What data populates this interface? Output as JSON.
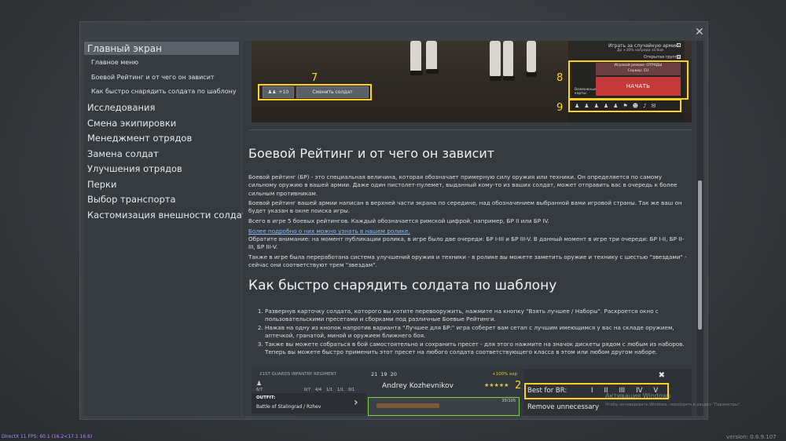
{
  "sidebar": {
    "items": [
      {
        "label": "Главный экран"
      },
      {
        "label": "Главное меню"
      },
      {
        "label": "Боевой Рейтинг и от чего он зависит"
      },
      {
        "label": "Как быстро снарядить солдата по шаблону"
      },
      {
        "label": "Исследования"
      },
      {
        "label": "Смена экипировки"
      },
      {
        "label": "Менеджмент отрядов"
      },
      {
        "label": "Замена солдат"
      },
      {
        "label": "Улучшения отрядов"
      },
      {
        "label": "Перки"
      },
      {
        "label": "Выбор транспорта"
      },
      {
        "label": "Кастомизация внешности солдат"
      }
    ]
  },
  "screenshot_top": {
    "random_army_label": "Играть за случайную армию",
    "random_army_bonus": "До +30% награда за бой",
    "open_group_label": "Открытая группа",
    "mode_label": "Игровой режим: ОТРЯДЫ",
    "server_label": "Сервер: EU",
    "start_label": "НАЧАТЬ",
    "possible_maps_label": "Возможные карты:",
    "change_soldier_label": "Сменить солдат",
    "squad_count": "+10",
    "marker_7": "7",
    "marker_8": "8",
    "marker_9": "9"
  },
  "section1": {
    "title": "Боевой Рейтинг и от чего он зависит",
    "p1": "Боевой рейтинг (БР) - это специальная величина, которая обозначает примерную силу оружия или техники. Он определяется по самому сильному оружию в вашей армии. Даже один пистолет-пулемет, выданный кому-то из ваших солдат, может отправить вас в очередь к более сильным противникам.",
    "p2": "Боевой рейтинг вашей армии написан в верхней части экрана по середине, над обозначением выбранной вами игровой страны. Так же ваш он будет указан в окне поиска игры.",
    "p3": "Всего в игре 5 боевых рейтингов. Каждый обозначается римской цифрой, например, БР II или БР IV.",
    "link": "Более подробно о них можно узнать в нашем ролике.",
    "p4": "Обратите внимание: на момент публикации ролика, в игре было две очереди: БР I-III и БР III-V. В данный момент в игре три очереди: БР I-II, БР II-III, БР III-V.",
    "p5": "Также в игре была переработана система улучшений оружия и техники - в ролике вы можете заметить оружие и технику с шестью \"звездами\" - сейчас они соответствуют трем \"звездам\"."
  },
  "section2": {
    "title": "Как быстро снарядить солдата по шаблону",
    "steps": [
      "Развернув карточку солдата, которого вы хотите перевооружить, нажмите на кнопку \"Взять лучшее / Наборы\". Раскроется окно с пользовательскими пресетами и сборками под различные Боевые Рейтинги.",
      "Нажав на одну из кнопок напротив варианта \"Лучшее для БР:\" игра соберет вам сетап с лучшим имеющимся у вас на складе оружием, аптечкой, гранатой, миной и оружием ближнего боя.",
      "Также вы можете собраться в бой самостоятельно и сохранить пресет - для этого нажмите на значок дискеты рядом с любым из наборов. Теперь вы можете быстро применить этот пресет на любого солдата соответствующего класса в этом или любом другом наборе."
    ]
  },
  "screenshot_bottom": {
    "regiment": "21ST GUARDS INFANTRY REGIMENT",
    "soldier_stats": "21",
    "stat2": "19",
    "stat3": "20",
    "exp": "+100% exp",
    "soldier_name": "Andrey Kozhevnikov",
    "squad_count": "6/7",
    "slot_counts": [
      "0/7",
      "4/4",
      "1/1",
      "1/1",
      "0/1"
    ],
    "outfit_label": "OUTFIT:",
    "outfit_value": "Battle of Stalingrad / Rzhev",
    "ammo": "35/105",
    "best_for_br_label": "Best for BR:",
    "br_options": [
      "I",
      "II",
      "III",
      "IV",
      "V"
    ],
    "remove_unnecessary": "Remove unnecessary",
    "marker_2": "2",
    "watermark_1": "Активация Windows",
    "watermark_2": "Чтобы активировать Windows, перейдите в раздел \"Параметры\"."
  },
  "footer": {
    "fps": "DirectX 11 FPS: 60.1 (16.2<17.1 16.6)",
    "version": "version: 0.6.9.107"
  },
  "colors": {
    "accent_yellow": "#ffd21f",
    "start_red": "#c43a3a",
    "link_blue": "#8fb6ff",
    "fps_purple": "#b48cff"
  }
}
